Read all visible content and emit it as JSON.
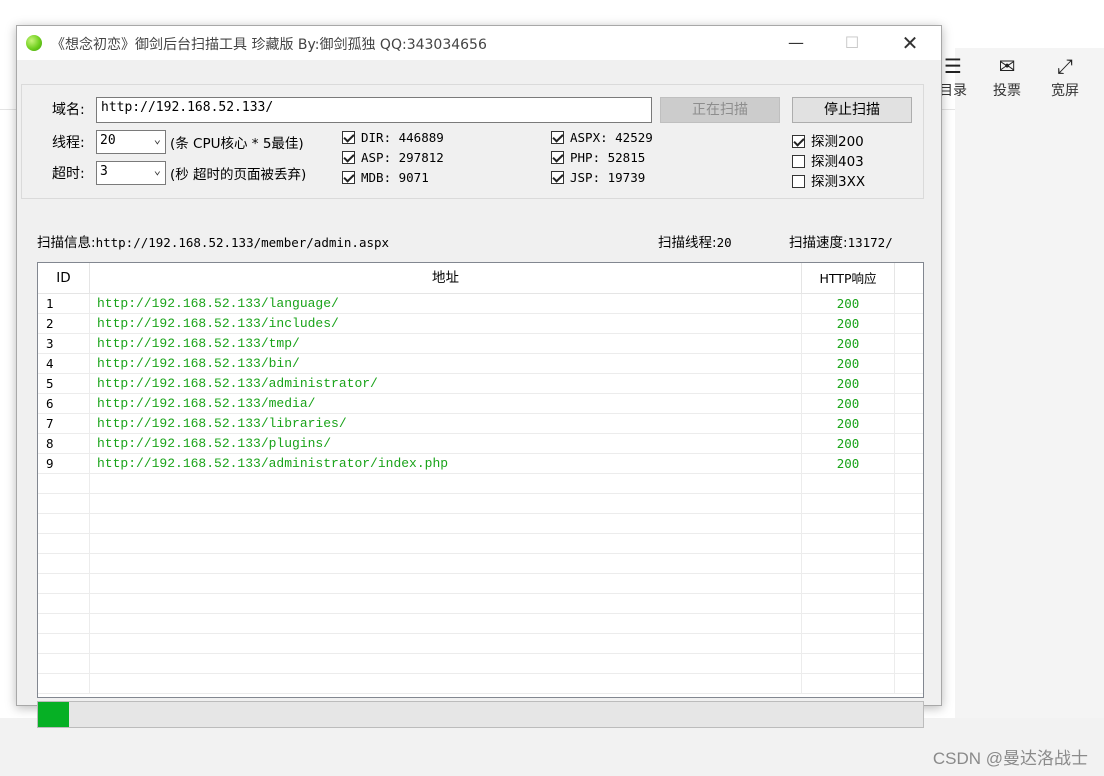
{
  "background": {
    "toolbar_fragment": "目录",
    "toolbar": [
      {
        "name": "catalog",
        "icon": "list-icon",
        "glyph": "☰",
        "label": "目录"
      },
      {
        "name": "vote",
        "icon": "vote-icon",
        "glyph": "✉",
        "label": "投票"
      },
      {
        "name": "widescreen",
        "icon": "expand-icon",
        "glyph": "⤢",
        "label": "宽屏"
      }
    ],
    "watermark": "CSDN @曼达洛战士"
  },
  "window": {
    "title": "《想念初恋》御剑后台扫描工具 珍藏版 By:御剑孤独 QQ:343034656",
    "minimize_glyph": "—",
    "maximize_glyph": "☐",
    "close_glyph": "✕"
  },
  "form": {
    "domain_label": "域名:",
    "domain_value": "http://192.168.52.133/",
    "scan_button": "正在扫描",
    "stop_button": "停止扫描",
    "threads_label": "线程:",
    "threads_value": "20",
    "threads_hint": "(条 CPU核心 * 5最佳)",
    "timeout_label": "超时:",
    "timeout_value": "3",
    "timeout_hint": "(秒 超时的页面被丢弃)",
    "dicts": [
      {
        "label": "DIR: 446889",
        "checked": true
      },
      {
        "label": "ASP: 297812",
        "checked": true
      },
      {
        "label": "MDB: 9071",
        "checked": true
      },
      {
        "label": "ASPX: 42529",
        "checked": true
      },
      {
        "label": "PHP: 52815",
        "checked": true
      },
      {
        "label": "JSP: 19739",
        "checked": true
      }
    ],
    "probes": [
      {
        "label": "探测200",
        "checked": true
      },
      {
        "label": "探测403",
        "checked": false
      },
      {
        "label": "探测3XX",
        "checked": false
      }
    ]
  },
  "status": {
    "scan_info_label": "扫描信息:",
    "scan_info_value": "http://192.168.52.133/member/admin.aspx",
    "threads_label": "扫描线程:",
    "threads_value": "20",
    "speed_label": "扫描速度:",
    "speed_value": "13172/"
  },
  "table": {
    "columns": [
      "ID",
      "地址",
      "HTTP响应"
    ],
    "rows": [
      {
        "id": "1",
        "url": "http://192.168.52.133/language/",
        "code": "200"
      },
      {
        "id": "2",
        "url": "http://192.168.52.133/includes/",
        "code": "200"
      },
      {
        "id": "3",
        "url": "http://192.168.52.133/tmp/",
        "code": "200"
      },
      {
        "id": "4",
        "url": "http://192.168.52.133/bin/",
        "code": "200"
      },
      {
        "id": "5",
        "url": "http://192.168.52.133/administrator/",
        "code": "200"
      },
      {
        "id": "6",
        "url": "http://192.168.52.133/media/",
        "code": "200"
      },
      {
        "id": "7",
        "url": "http://192.168.52.133/libraries/",
        "code": "200"
      },
      {
        "id": "8",
        "url": "http://192.168.52.133/plugins/",
        "code": "200"
      },
      {
        "id": "9",
        "url": "http://192.168.52.133/administrator/index.php",
        "code": "200"
      }
    ],
    "empty_rows": 11
  },
  "progress": {
    "fraction": 0.035,
    "color": "#06b025"
  },
  "colors": {
    "result_text": "#1aa31a",
    "window_bg": "#f0f0f0"
  }
}
